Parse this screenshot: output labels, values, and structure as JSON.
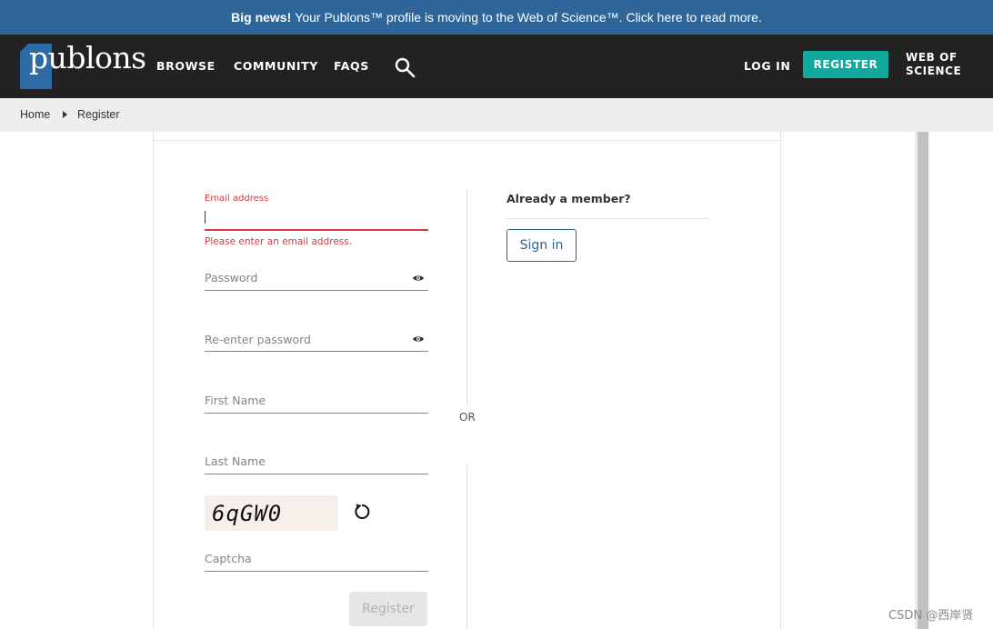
{
  "announcement": {
    "bold": "Big news!",
    "text": "Your Publons™ profile is moving to the Web of Science™. Click here to read more."
  },
  "header": {
    "logo": "publons",
    "nav": [
      "BROWSE",
      "COMMUNITY",
      "FAQS"
    ],
    "login": "LOG IN",
    "register": "REGISTER",
    "wos_line1": "WEB OF",
    "wos_line2": "SCIENCE",
    "search_icon": "search-icon"
  },
  "breadcrumb": {
    "home": "Home",
    "current": "Register"
  },
  "form": {
    "email_label": "Email address",
    "email_value": "",
    "email_error": "Please enter an email address.",
    "password_placeholder": "Password",
    "reenter_placeholder": "Re-enter password",
    "first_name_placeholder": "First Name",
    "last_name_placeholder": "Last Name",
    "captcha_code": "6qGW0",
    "captcha_placeholder": "Captcha",
    "submit_label": "Register"
  },
  "or_text": "OR",
  "member": {
    "title": "Already a member?",
    "signin_label": "Sign in"
  },
  "watermark": "CSDN @西岸贤",
  "colors": {
    "banner": "#2f6699",
    "nav": "#222222",
    "accent": "#11a99d",
    "error": "#d43a3a"
  }
}
